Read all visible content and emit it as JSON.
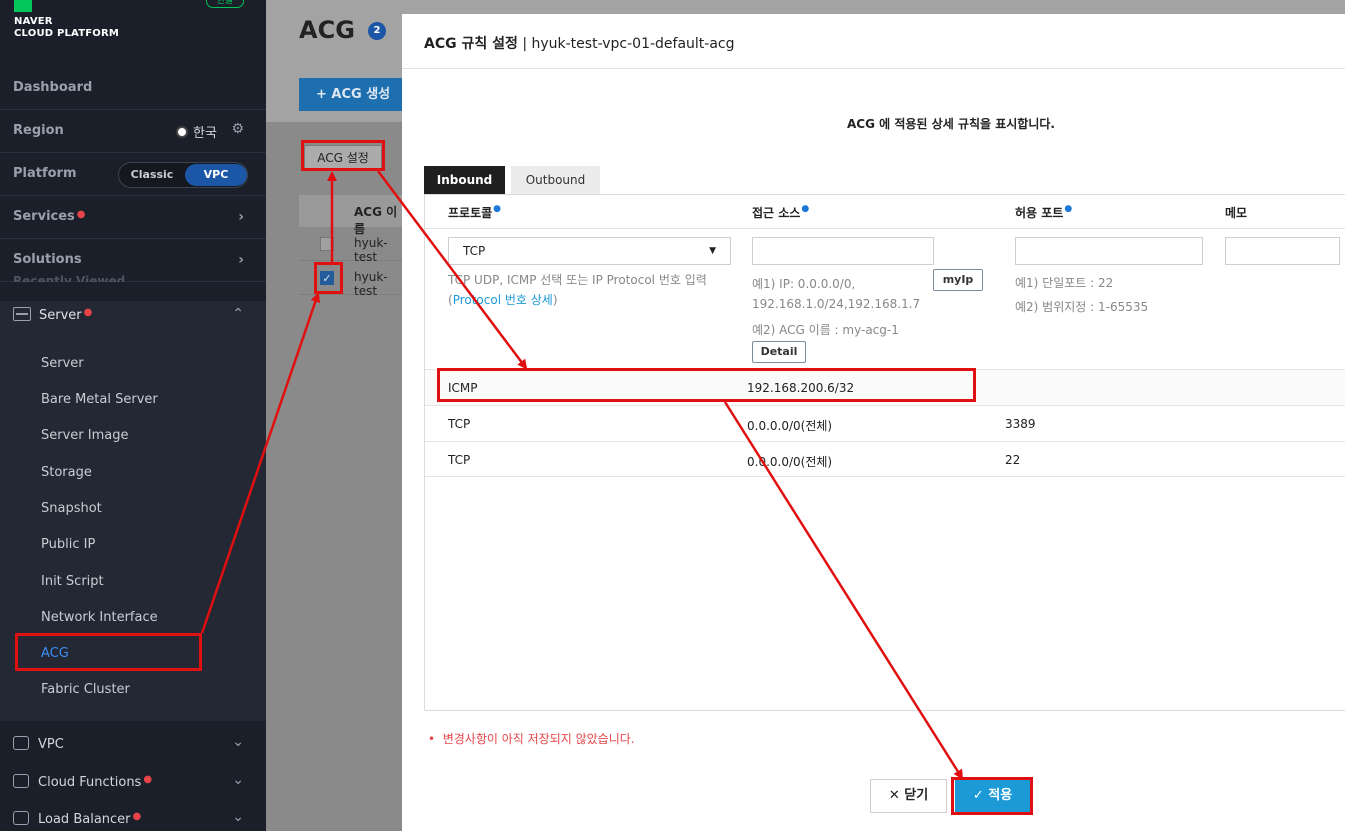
{
  "sidebar": {
    "brand_line1": "NAVER",
    "brand_line2": "CLOUD PLATFORM",
    "lang_badge": "한글",
    "dashboard": "Dashboard",
    "region_label": "Region",
    "region_value": "한국",
    "platform_label": "Platform",
    "platform_classic": "Classic",
    "platform_vpc": "VPC",
    "services": "Services",
    "solutions": "Solutions",
    "recently_viewed": "Recently Viewed",
    "server_section": "Server",
    "server_items": [
      "Server",
      "Bare Metal Server",
      "Server Image",
      "Storage",
      "Snapshot",
      "Public IP",
      "Init Script",
      "Network Interface",
      "ACG",
      "Fabric Cluster"
    ],
    "active_item": "ACG",
    "bottom_items": [
      "VPC",
      "Cloud Functions",
      "Load Balancer"
    ]
  },
  "main": {
    "title": "ACG",
    "count": "2",
    "create_button": "+ ACG 생성",
    "setting_button": "ACG 설정",
    "table_header_name": "ACG 이름",
    "rows": [
      "hyuk-test",
      "hyuk-test"
    ]
  },
  "modal": {
    "title_bold": "ACG 규칙 설정",
    "title_rest": " | hyuk-test-vpc-01-default-acg",
    "description": "ACG 에 적용된 상세 규칙을 표시합니다.",
    "tabs": {
      "inbound": "Inbound",
      "outbound": "Outbound"
    },
    "columns": {
      "protocol": "프로토콜",
      "source": "접근 소스",
      "port": "허용 포트",
      "memo": "메모"
    },
    "protocol_selected": "TCP",
    "protocol_hint_1": "TCP UDP, ICMP 선택 또는 IP Protocol 번호 입력",
    "protocol_hint_open": "(",
    "protocol_hint_link": "Protocol 번호 상세",
    "protocol_hint_close": ")",
    "source_hint_1": "예1) IP: 0.0.0.0/0,",
    "source_hint_2": "192.168.1.0/24,192.168.1.7",
    "source_hint_3": "예2) ACG 이름 : my-acg-1",
    "myip_button": "myIp",
    "detail_button": "Detail",
    "port_hint_1": "예1) 단일포트 : 22",
    "port_hint_2": "예2) 범위지정 : 1-65535",
    "rules": [
      {
        "protocol": "ICMP",
        "source": "192.168.200.6/32",
        "port": ""
      },
      {
        "protocol": "TCP",
        "source": "0.0.0.0/0(전체)",
        "port": "3389"
      },
      {
        "protocol": "TCP",
        "source": "0.0.0.0/0(전체)",
        "port": "22"
      }
    ],
    "unsaved_notice": "변경사항이 아직 저장되지 않았습니다.",
    "close_button": "닫기",
    "apply_button": "적용"
  },
  "colors": {
    "annotation": "#e01010",
    "accent": "#1b9ad6",
    "sidebar_bg": "#1b1f2a"
  }
}
